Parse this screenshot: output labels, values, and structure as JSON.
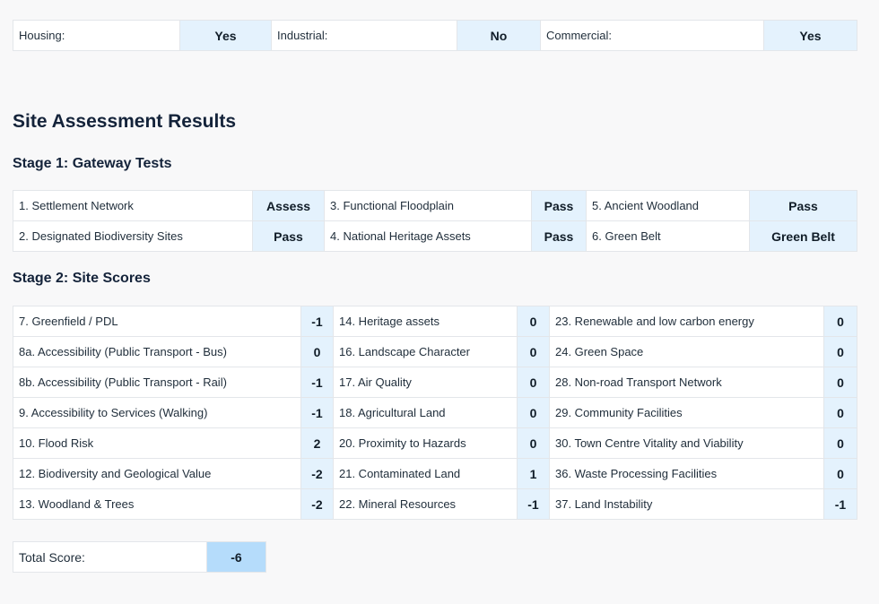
{
  "uses": [
    {
      "label": "Housing:",
      "value": "Yes"
    },
    {
      "label": "Industrial:",
      "value": "No"
    },
    {
      "label": "Commercial:",
      "value": "Yes"
    }
  ],
  "results_title": "Site Assessment Results",
  "stage1": {
    "title": "Stage 1: Gateway Tests",
    "rows": [
      [
        {
          "label": "1. Settlement Network",
          "value": "Assess"
        },
        {
          "label": "3. Functional Floodplain",
          "value": "Pass"
        },
        {
          "label": "5. Ancient Woodland",
          "value": "Pass"
        }
      ],
      [
        {
          "label": "2. Designated Biodiversity Sites",
          "value": "Pass"
        },
        {
          "label": "4. National Heritage Assets",
          "value": "Pass"
        },
        {
          "label": "6. Green Belt",
          "value": "Green Belt"
        }
      ]
    ]
  },
  "stage2": {
    "title": "Stage 2: Site Scores",
    "rows": [
      [
        {
          "label": "7. Greenfield / PDL",
          "value": "-1"
        },
        {
          "label": "14. Heritage assets",
          "value": "0"
        },
        {
          "label": "23. Renewable and low carbon energy",
          "value": "0"
        }
      ],
      [
        {
          "label": "8a. Accessibility (Public Transport - Bus)",
          "value": "0"
        },
        {
          "label": "16. Landscape Character",
          "value": "0"
        },
        {
          "label": "24. Green Space",
          "value": "0"
        }
      ],
      [
        {
          "label": "8b. Accessibility (Public Transport - Rail)",
          "value": "-1"
        },
        {
          "label": "17. Air Quality",
          "value": "0"
        },
        {
          "label": "28. Non-road Transport Network",
          "value": "0"
        }
      ],
      [
        {
          "label": "9. Accessibility to Services (Walking)",
          "value": "-1"
        },
        {
          "label": "18. Agricultural Land",
          "value": "0"
        },
        {
          "label": "29. Community Facilities",
          "value": "0"
        }
      ],
      [
        {
          "label": "10. Flood Risk",
          "value": "2"
        },
        {
          "label": "20. Proximity to Hazards",
          "value": "0"
        },
        {
          "label": "30. Town Centre Vitality and Viability",
          "value": "0"
        }
      ],
      [
        {
          "label": "12. Biodiversity and Geological Value",
          "value": "-2"
        },
        {
          "label": "21. Contaminated Land",
          "value": "1"
        },
        {
          "label": "36. Waste Processing Facilities",
          "value": "0"
        }
      ],
      [
        {
          "label": "13. Woodland & Trees",
          "value": "-2"
        },
        {
          "label": "22. Mineral Resources",
          "value": "-1"
        },
        {
          "label": "37. Land Instability",
          "value": "-1"
        }
      ]
    ]
  },
  "total": {
    "label": "Total Score:",
    "value": "-6"
  }
}
